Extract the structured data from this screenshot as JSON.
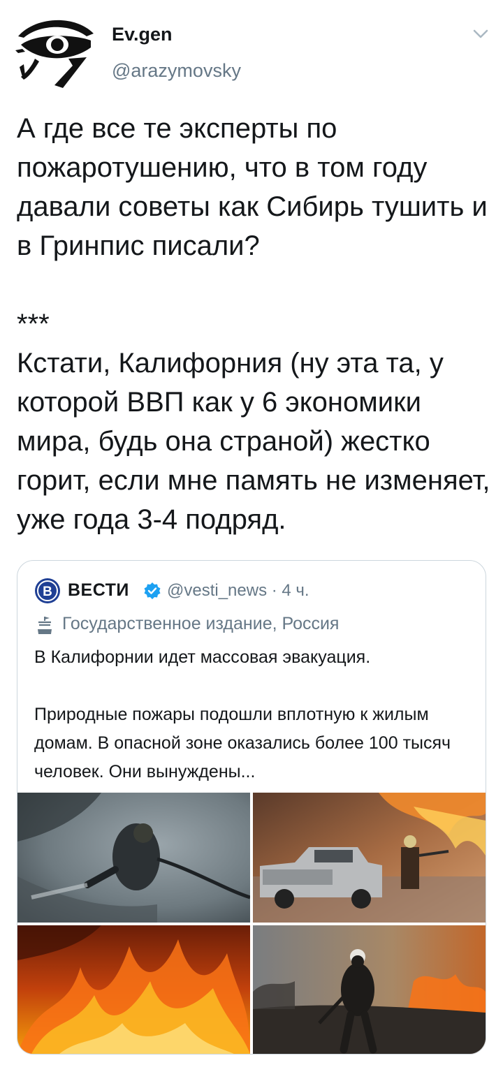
{
  "author": {
    "display_name": "Ev.gen",
    "handle": "@arazymovsky",
    "avatar_icon": "eye-of-horus-icon"
  },
  "menu_icon": "chevron-down-icon",
  "tweet": {
    "text": "А где все те эксперты по пожаротушению, что в том году давали советы как Сибирь тушить и в Гринпис писали?\n\n***\nКстати, Калифорния (ну эта та, у которой ВВП как у 6 экономики мира, будь она страной) жестко горит, если мне память не изменяет, уже года 3-4 подряд."
  },
  "quoted_tweet": {
    "logo_icon": "vesti-logo-icon",
    "display_name": "ВЕСТИ",
    "verified_icon": "verified-badge-icon",
    "handle_time": "@vesti_news · 4 ч.",
    "label_icon": "state-media-icon",
    "label": "Государственное издание, Россия",
    "text": "В Калифорнии идет массовая эвакуация.\n\nПриродные пожары подошли вплотную к жилым домам. В опасной зоне оказались более 100 тысяч человек. Они вынуждены...",
    "photos": [
      "firefighter-spraying-hose-photo",
      "firefighter-next-to-pickup-truck-photo",
      "wildfire-flames-photo",
      "firefighter-walking-through-burnt-field-photo"
    ]
  },
  "colors": {
    "text": "#14171a",
    "secondary": "#657786",
    "border": "#ccd6dd",
    "verified": "#1da1f2",
    "vesti_blue": "#1f3f94"
  }
}
